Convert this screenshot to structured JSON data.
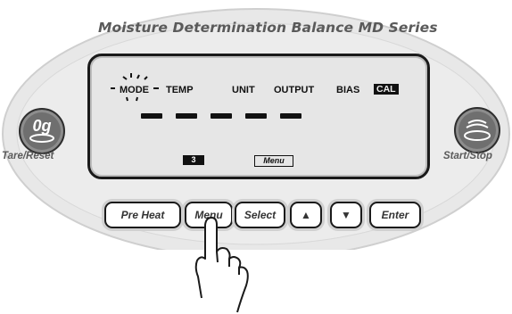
{
  "device": {
    "title": "Moisture Determination Balance  MD Series"
  },
  "side_buttons": {
    "left_symbol": "0g",
    "left_label": "Tare/Reset",
    "right_label": "Start/Stop"
  },
  "display": {
    "modes": [
      "MODE",
      "TEMP",
      "UNIT",
      "OUTPUT",
      "BIAS",
      "CAL"
    ],
    "number_box": "3",
    "menu_box": "Menu"
  },
  "keys": {
    "preheat": "Pre Heat",
    "menu": "Menu",
    "select": "Select",
    "up": "▲",
    "down": "▼",
    "enter": "Enter"
  }
}
